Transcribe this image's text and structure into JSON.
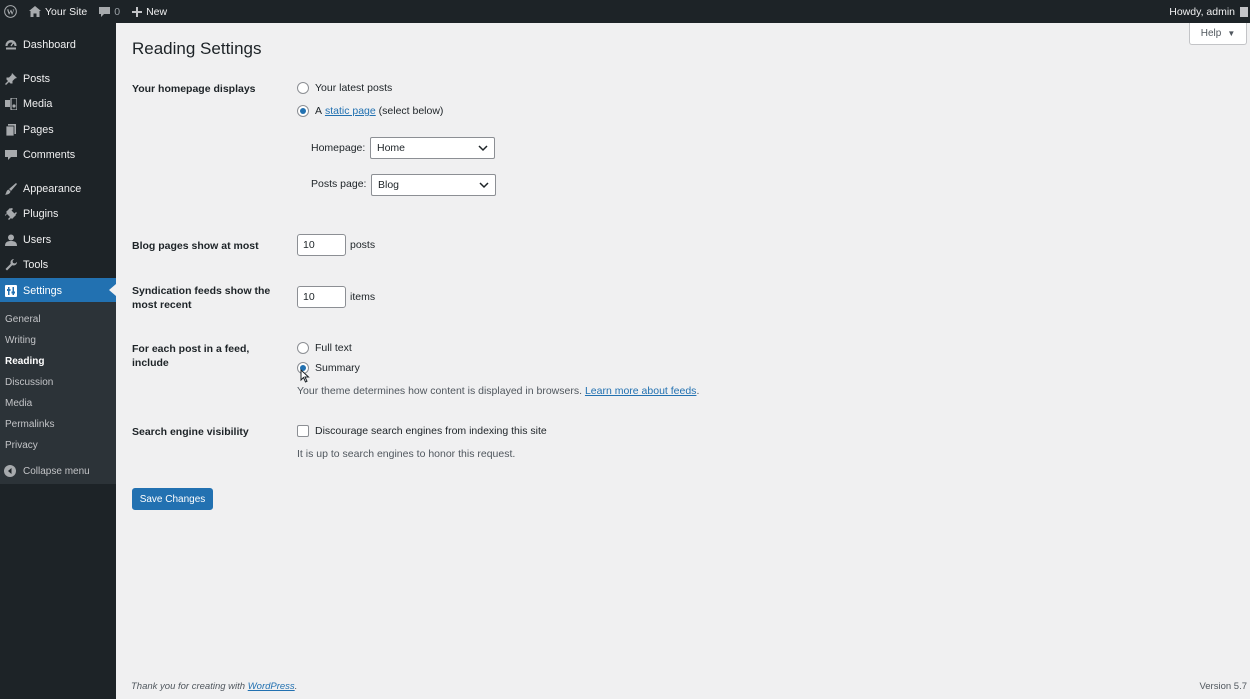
{
  "admin_bar": {
    "site_name": "Your Site",
    "comments_count": "0",
    "new_label": "New",
    "greeting": "Howdy, admin"
  },
  "sidebar": {
    "menu": [
      {
        "label": "Dashboard",
        "icon": "dashboard-icon"
      },
      {
        "label": "Posts",
        "icon": "pin-icon"
      },
      {
        "label": "Media",
        "icon": "media-icon"
      },
      {
        "label": "Pages",
        "icon": "pages-icon"
      },
      {
        "label": "Comments",
        "icon": "comment-icon"
      },
      {
        "label": "Appearance",
        "icon": "brush-icon"
      },
      {
        "label": "Plugins",
        "icon": "plug-icon"
      },
      {
        "label": "Users",
        "icon": "user-icon"
      },
      {
        "label": "Tools",
        "icon": "wrench-icon"
      },
      {
        "label": "Settings",
        "icon": "settings-icon"
      }
    ],
    "submenu": [
      "General",
      "Writing",
      "Reading",
      "Discussion",
      "Media",
      "Permalinks",
      "Privacy"
    ],
    "collapse_label": "Collapse menu"
  },
  "header": {
    "help_label": "Help",
    "title": "Reading Settings"
  },
  "homepage": {
    "label": "Your homepage displays",
    "option_latest": "Your latest posts",
    "option_static_prefix": "A",
    "option_static_link": "static page",
    "option_static_suffix": "(select below)",
    "homepage_label": "Homepage:",
    "homepage_value": "Home",
    "posts_page_label": "Posts page:",
    "posts_page_value": "Blog"
  },
  "blog_pages": {
    "label": "Blog pages show at most",
    "value": "10",
    "suffix": "posts"
  },
  "syndication": {
    "label": "Syndication feeds show the most recent",
    "value": "10",
    "suffix": "items"
  },
  "feed_include": {
    "label": "For each post in a feed, include",
    "option_full": "Full text",
    "option_summary": "Summary",
    "description": "Your theme determines how content is displayed in browsers.",
    "learn_more": "Learn more about feeds"
  },
  "search_visibility": {
    "label": "Search engine visibility",
    "checkbox_label": "Discourage search engines from indexing this site",
    "description": "It is up to search engines to honor this request."
  },
  "save_label": "Save Changes",
  "footer": {
    "thanks_prefix": "Thank you for creating with",
    "wordpress_link": "WordPress",
    "thanks_suffix": ".",
    "version": "Version 5.7"
  },
  "colors": {
    "admin_bar": "#1d2327",
    "accent": "#2271b1",
    "submenu_bg": "#2c3338",
    "content_bg": "#f0f0f1"
  }
}
